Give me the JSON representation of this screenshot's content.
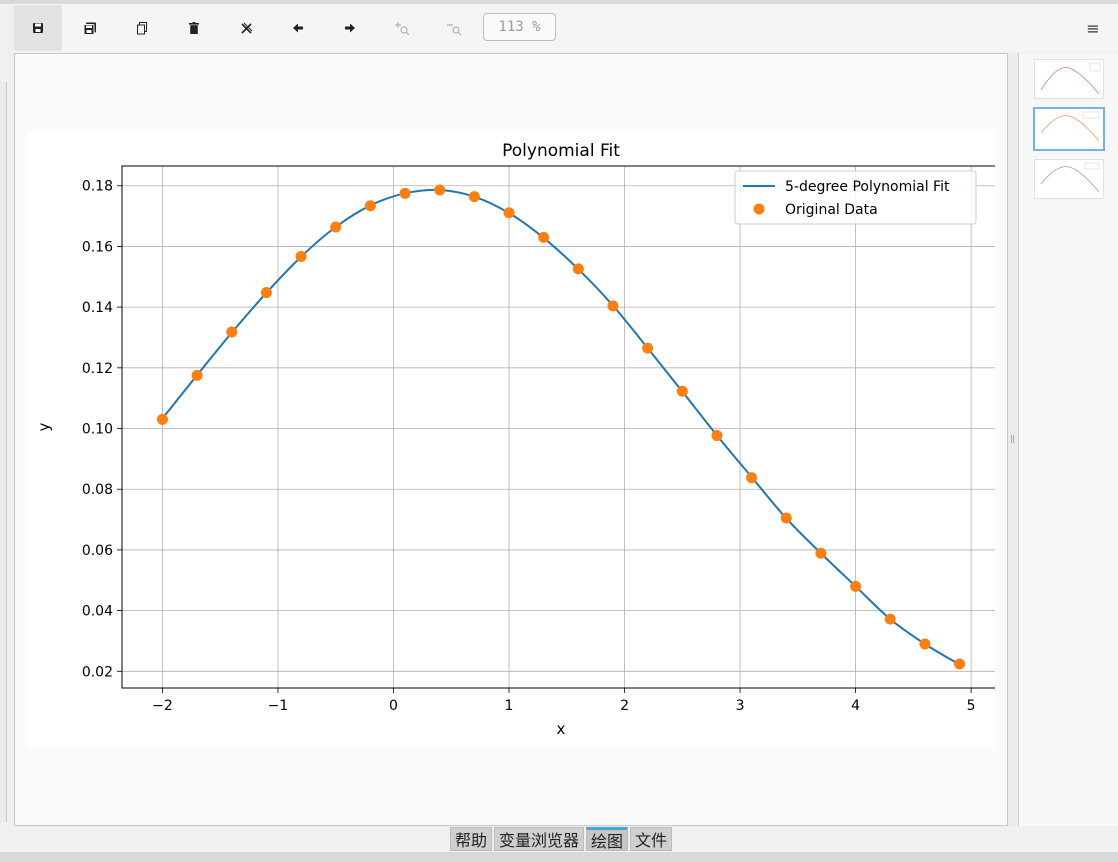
{
  "toolbar": {
    "buttons": [
      {
        "name": "save-icon",
        "glyph": "💾"
      },
      {
        "name": "save-all-icon",
        "glyph": "🖫"
      },
      {
        "name": "copy-icon",
        "glyph": "⧉"
      },
      {
        "name": "delete-icon",
        "glyph": "🗑"
      },
      {
        "name": "delete-all-icon",
        "glyph": "✕"
      },
      {
        "name": "previous-icon",
        "glyph": "←"
      },
      {
        "name": "next-icon",
        "glyph": "→"
      },
      {
        "name": "zoom-in-icon",
        "glyph": "+"
      },
      {
        "name": "zoom-out-icon",
        "glyph": "−"
      }
    ],
    "zoom": "113 %",
    "menu_glyph": "≡"
  },
  "tabs": [
    "帮助",
    "变量浏览器",
    "绘图",
    "文件"
  ],
  "active_tab": "绘图",
  "thumbnails": {
    "count": 3,
    "selected_index": 1
  },
  "colors": {
    "fit_line": "#1f77b4",
    "data_points": "#ff7f0e",
    "tab_active": "#4aa3df"
  },
  "chart_data": {
    "type": "line",
    "title": "Polynomial Fit",
    "xlabel": "x",
    "ylabel": "y",
    "xlim": [
      -2.35,
      5.25
    ],
    "ylim": [
      0.0145,
      0.1865
    ],
    "xticks": [
      -2,
      -1,
      0,
      1,
      2,
      3,
      4,
      5
    ],
    "xtick_labels": [
      "−2",
      "−1",
      "0",
      "1",
      "2",
      "3",
      "4",
      "5"
    ],
    "yticks": [
      0.02,
      0.04,
      0.06,
      0.08,
      0.1,
      0.12,
      0.14,
      0.16,
      0.18
    ],
    "ytick_labels": [
      "0.02",
      "0.04",
      "0.06",
      "0.08",
      "0.10",
      "0.12",
      "0.14",
      "0.16",
      "0.18"
    ],
    "grid": true,
    "legend_position": "top-right",
    "series": [
      {
        "name": "5-degree Polynomial Fit",
        "kind": "line",
        "x": [
          -2.0,
          -1.7,
          -1.4,
          -1.1,
          -0.8,
          -0.5,
          -0.2,
          0.1,
          0.4,
          0.7,
          1.0,
          1.3,
          1.6,
          1.9,
          2.2,
          2.5,
          2.8,
          3.1,
          3.4,
          3.7,
          4.0,
          4.3,
          4.6,
          4.9
        ],
        "y": [
          0.1033,
          0.1176,
          0.1316,
          0.1447,
          0.1566,
          0.1664,
          0.1735,
          0.1775,
          0.1786,
          0.1764,
          0.171,
          0.1628,
          0.1525,
          0.1405,
          0.1265,
          0.1122,
          0.0977,
          0.084,
          0.0704,
          0.0589,
          0.048,
          0.0372,
          0.029,
          0.0222
        ]
      },
      {
        "name": "Original Data",
        "kind": "scatter",
        "x": [
          -2.0,
          -1.7,
          -1.4,
          -1.1,
          -0.8,
          -0.5,
          -0.2,
          0.1,
          0.4,
          0.7,
          1.0,
          1.3,
          1.6,
          1.9,
          2.2,
          2.5,
          2.8,
          3.1,
          3.4,
          3.7,
          4.0,
          4.3,
          4.6,
          4.9
        ],
        "y": [
          0.103,
          0.1175,
          0.1318,
          0.1448,
          0.1567,
          0.1664,
          0.1734,
          0.1775,
          0.1786,
          0.1764,
          0.1711,
          0.163,
          0.1526,
          0.1404,
          0.1265,
          0.1123,
          0.0977,
          0.0838,
          0.0705,
          0.0589,
          0.048,
          0.0372,
          0.029,
          0.0224
        ]
      }
    ]
  }
}
